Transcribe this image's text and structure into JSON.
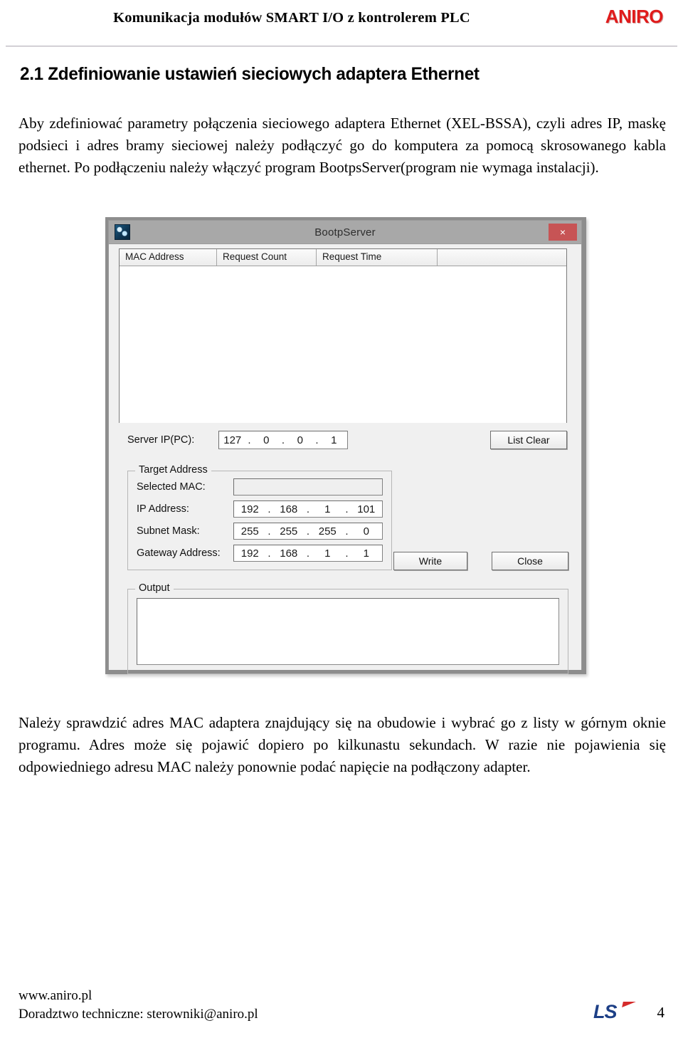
{
  "header": {
    "title": "Komunikacja modułów SMART I/O z kontrolerem PLC",
    "logo": "ANIRO",
    "logo_color": "#e01b1b"
  },
  "section": {
    "heading": "2.1 Zdefiniowanie ustawień sieciowych adaptera Ethernet",
    "intro_paragraph": "Aby zdefiniować parametry połączenia  sieciowego adaptera Ethernet (XEL-BSSA), czyli adres IP, maskę podsieci i adres bramy sieciowej należy podłączyć go do komputera za pomocą skrosowanego kabla ethernet. Po podłączeniu należy włączyć program BootpsServer(program nie wymaga instalacji).",
    "closing_paragraph": "Należy sprawdzić adres MAC adaptera znajdujący się na obudowie i wybrać go z listy w górnym oknie programu. Adres może się pojawić dopiero po kilkunastu sekundach. W razie nie pojawienia się odpowiedniego adresu MAC należy ponownie podać napięcie na podłączony adapter."
  },
  "dialog": {
    "title": "BootpServer",
    "icon": "app-icon",
    "close_label": "×",
    "close_color": "#c75455",
    "titlebar_color": "#a8a8a8",
    "list": {
      "columns": [
        "MAC Address",
        "Request Count",
        "Request Time",
        ""
      ],
      "rows": []
    },
    "server_ip": {
      "label": "Server IP(PC):",
      "octets": [
        "127",
        "0",
        "0",
        "1"
      ]
    },
    "list_clear_label": "List Clear",
    "target_address": {
      "legend": "Target Address",
      "selected_mac_label": "Selected MAC:",
      "selected_mac_value": "",
      "ip_address_label": "IP Address:",
      "ip_address_octets": [
        "192",
        "168",
        "1",
        "101"
      ],
      "subnet_mask_label": "Subnet Mask:",
      "subnet_mask_octets": [
        "255",
        "255",
        "255",
        "0"
      ],
      "gateway_label": "Gateway Address:",
      "gateway_octets": [
        "192",
        "168",
        "1",
        "1"
      ]
    },
    "write_label": "Write",
    "close_button_label": "Close",
    "output": {
      "legend": "Output",
      "value": ""
    }
  },
  "footer": {
    "url": "www.aniro.pl",
    "contact": "Doradztwo techniczne: sterowniki@aniro.pl",
    "logo": "LS",
    "logo_color": "#1d3f86",
    "page_number": "4"
  }
}
